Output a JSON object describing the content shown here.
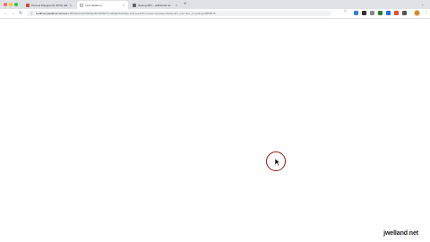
{
  "browser": {
    "tabs": [
      {
        "label": "Pentest Playground (DVS) GE",
        "active": false
      },
      {
        "label": "mod-details-ui",
        "active": true
      },
      {
        "label": "Testing ADV - Additional Javafx Feature",
        "active": false
      }
    ],
    "new_tab": "+",
    "tabs_menu": "⌄",
    "address": {
      "host": "localhost:jwelland.com/xss.",
      "path": "b35ffbab4cdc2b26ba28/c63b8cb7ed/fafeb/6e3/a3e-1f3ecee1/chromeservicesteambackend?_test=ded_ci=settings/0852678"
    },
    "nav": {
      "back": "←",
      "forward": "→",
      "reload": "↻",
      "lock": "ⓘ"
    },
    "star": "☆",
    "menu": "⋮"
  },
  "page": {
    "watermark": {
      "brand": "jwelland",
      "dot": ".",
      "tld": "net"
    }
  }
}
